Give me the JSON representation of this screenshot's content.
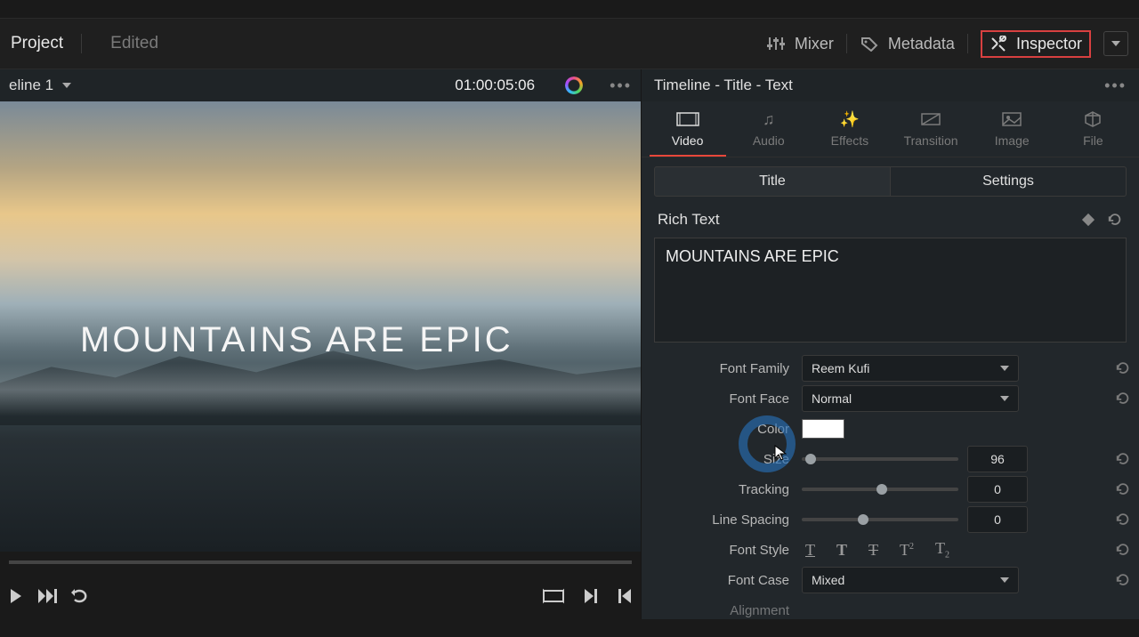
{
  "header": {
    "project": "Project",
    "status": "Edited",
    "mixer": "Mixer",
    "metadata": "Metadata",
    "inspector": "Inspector"
  },
  "timeline_bar": {
    "name": "eline 1",
    "timecode": "01:00:05:06"
  },
  "viewer": {
    "title": "MOUNTAINS ARE EPIC"
  },
  "inspector": {
    "header": "Timeline - Title - Text",
    "tabs": {
      "video": "Video",
      "audio": "Audio",
      "effects": "Effects",
      "transition": "Transition",
      "image": "Image",
      "file": "File"
    },
    "mode": {
      "title": "Title",
      "settings": "Settings"
    },
    "section": "Rich Text",
    "text_value": "MOUNTAINS ARE EPIC",
    "props": {
      "font_family": {
        "label": "Font Family",
        "value": "Reem Kufi"
      },
      "font_face": {
        "label": "Font Face",
        "value": "Normal"
      },
      "color": {
        "label": "Color",
        "value": "#FFFFFF"
      },
      "size": {
        "label": "Size",
        "value": "96",
        "pct": 2
      },
      "tracking": {
        "label": "Tracking",
        "value": "0",
        "pct": 50
      },
      "line_spacing": {
        "label": "Line Spacing",
        "value": "0",
        "pct": 38
      },
      "font_style": {
        "label": "Font Style"
      },
      "font_case": {
        "label": "Font Case",
        "value": "Mixed"
      },
      "alignment": {
        "label": "Alignment"
      }
    }
  }
}
